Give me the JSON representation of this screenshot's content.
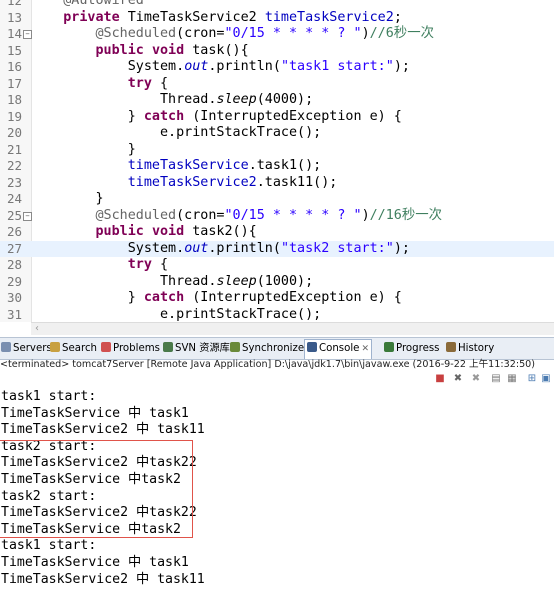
{
  "editor": {
    "lines": [
      {
        "n": "12",
        "segs": [
          {
            "t": "    "
          },
          {
            "t": "@Autowired",
            "c": "ann"
          }
        ]
      },
      {
        "n": "13",
        "segs": [
          {
            "t": "    "
          },
          {
            "t": "private",
            "c": "kw"
          },
          {
            "t": " TimeTaskService2 "
          },
          {
            "t": "timeTaskService2",
            "c": "fld"
          },
          {
            "t": ";"
          }
        ]
      },
      {
        "n": "14",
        "fold": "−",
        "segs": [
          {
            "t": "        "
          },
          {
            "t": "@Scheduled",
            "c": "ann"
          },
          {
            "t": "(cron="
          },
          {
            "t": "\"0/15 * * * * ? \"",
            "c": "str"
          },
          {
            "t": ")"
          },
          {
            "t": "//6秒一次",
            "c": "com"
          }
        ]
      },
      {
        "n": "15",
        "segs": [
          {
            "t": "        "
          },
          {
            "t": "public",
            "c": "kw"
          },
          {
            "t": " "
          },
          {
            "t": "void",
            "c": "kw"
          },
          {
            "t": " task(){"
          }
        ]
      },
      {
        "n": "16",
        "segs": [
          {
            "t": "            System."
          },
          {
            "t": "out",
            "c": "fld ital"
          },
          {
            "t": ".println("
          },
          {
            "t": "\"task1 start:\"",
            "c": "str"
          },
          {
            "t": ");"
          }
        ]
      },
      {
        "n": "17",
        "segs": [
          {
            "t": "            "
          },
          {
            "t": "try",
            "c": "kw"
          },
          {
            "t": " {"
          }
        ]
      },
      {
        "n": "18",
        "segs": [
          {
            "t": "                Thread."
          },
          {
            "t": "sleep",
            "c": "ital"
          },
          {
            "t": "(4000);"
          }
        ]
      },
      {
        "n": "19",
        "segs": [
          {
            "t": "            } "
          },
          {
            "t": "catch",
            "c": "kw"
          },
          {
            "t": " (InterruptedException e) {"
          }
        ]
      },
      {
        "n": "20",
        "segs": [
          {
            "t": "                e.printStackTrace();"
          }
        ]
      },
      {
        "n": "21",
        "segs": [
          {
            "t": "            }"
          }
        ]
      },
      {
        "n": "22",
        "segs": [
          {
            "t": "            "
          },
          {
            "t": "timeTaskService",
            "c": "fld"
          },
          {
            "t": ".task1();"
          }
        ]
      },
      {
        "n": "23",
        "segs": [
          {
            "t": "            "
          },
          {
            "t": "timeTaskService2",
            "c": "fld"
          },
          {
            "t": ".task11();"
          }
        ]
      },
      {
        "n": "24",
        "segs": [
          {
            "t": "        }"
          }
        ]
      },
      {
        "n": "25",
        "fold": "−",
        "segs": [
          {
            "t": "        "
          },
          {
            "t": "@Scheduled",
            "c": "ann"
          },
          {
            "t": "(cron="
          },
          {
            "t": "\"0/15 * * * * ? \"",
            "c": "str"
          },
          {
            "t": ")"
          },
          {
            "t": "//16秒一次",
            "c": "com"
          }
        ]
      },
      {
        "n": "26",
        "segs": [
          {
            "t": "        "
          },
          {
            "t": "public",
            "c": "kw"
          },
          {
            "t": " "
          },
          {
            "t": "void",
            "c": "kw"
          },
          {
            "t": " task2(){"
          }
        ]
      },
      {
        "n": "27",
        "current": true,
        "segs": [
          {
            "t": "            System."
          },
          {
            "t": "out",
            "c": "fld ital"
          },
          {
            "t": ".println("
          },
          {
            "t": "\"task2 start:\"",
            "c": "str"
          },
          {
            "t": ");"
          }
        ]
      },
      {
        "n": "28",
        "segs": [
          {
            "t": "            "
          },
          {
            "t": "try",
            "c": "kw"
          },
          {
            "t": " {"
          }
        ]
      },
      {
        "n": "29",
        "segs": [
          {
            "t": "                Thread."
          },
          {
            "t": "sleep",
            "c": "ital"
          },
          {
            "t": "(1000);"
          }
        ]
      },
      {
        "n": "30",
        "segs": [
          {
            "t": "            } "
          },
          {
            "t": "catch",
            "c": "kw"
          },
          {
            "t": " (InterruptedException e) {"
          }
        ]
      },
      {
        "n": "31",
        "segs": [
          {
            "t": "                e.printStackTrace();"
          }
        ]
      }
    ]
  },
  "tabs": [
    {
      "label": "Servers",
      "icon": "servers-icon",
      "color": "#7a8fb0"
    },
    {
      "label": "Search",
      "icon": "search-icon",
      "color": "#c8a040"
    },
    {
      "label": "Problems",
      "icon": "problems-icon",
      "color": "#d05050"
    },
    {
      "label": "SVN 资源库",
      "icon": "svn-icon",
      "color": "#4a7a4a"
    },
    {
      "label": "Synchronize",
      "icon": "synchronize-icon",
      "color": "#6a8a3a"
    },
    {
      "label": "Console",
      "icon": "console-icon",
      "color": "#3a5a8a",
      "active": true,
      "close": "✕"
    },
    {
      "label": "Progress",
      "icon": "progress-icon",
      "color": "#3a7a3a"
    },
    {
      "label": "History",
      "icon": "history-icon",
      "color": "#8a6a3a"
    }
  ],
  "status": "<terminated> tomcat7Server [Remote Java Application] D:\\java\\jdk1.7\\bin\\javaw.exe (2016-9-22 上午11:32:50)",
  "toolbar": [
    {
      "name": "terminate-icon",
      "glyph": "■",
      "color": "#c84040"
    },
    {
      "name": "remove-launch-icon",
      "glyph": "✖",
      "color": "#666666"
    },
    {
      "name": "remove-all-icon",
      "glyph": "✖",
      "color": "#999999"
    },
    {
      "name": "clear-console-icon",
      "glyph": "▤",
      "color": "#777777"
    },
    {
      "name": "scroll-lock-icon",
      "glyph": "▦",
      "color": "#777777"
    },
    {
      "name": "pin-console-icon",
      "glyph": "⊞",
      "color": "#4a7ab0"
    },
    {
      "name": "display-console-icon",
      "glyph": "▣",
      "color": "#4a7ab0"
    },
    {
      "name": "open-console-icon",
      "glyph": "▭",
      "color": "#4a7ab0"
    }
  ],
  "console": [
    "task1 start:",
    "TimeTaskService 中 task1",
    "TimeTaskService2 中 task11",
    "task2 start:",
    "TimeTaskService2 中task22",
    "TimeTaskService 中task2",
    "task2 start:",
    "TimeTaskService2 中task22",
    "TimeTaskService 中task2",
    "task1 start:",
    "TimeTaskService 中 task1",
    "TimeTaskService2 中 task11"
  ],
  "colors": {
    "highlight_box": "#e0534a",
    "keyword": "#7f0055",
    "string": "#2a00ff",
    "field": "#0000c0",
    "comment": "#3f7f5f"
  }
}
